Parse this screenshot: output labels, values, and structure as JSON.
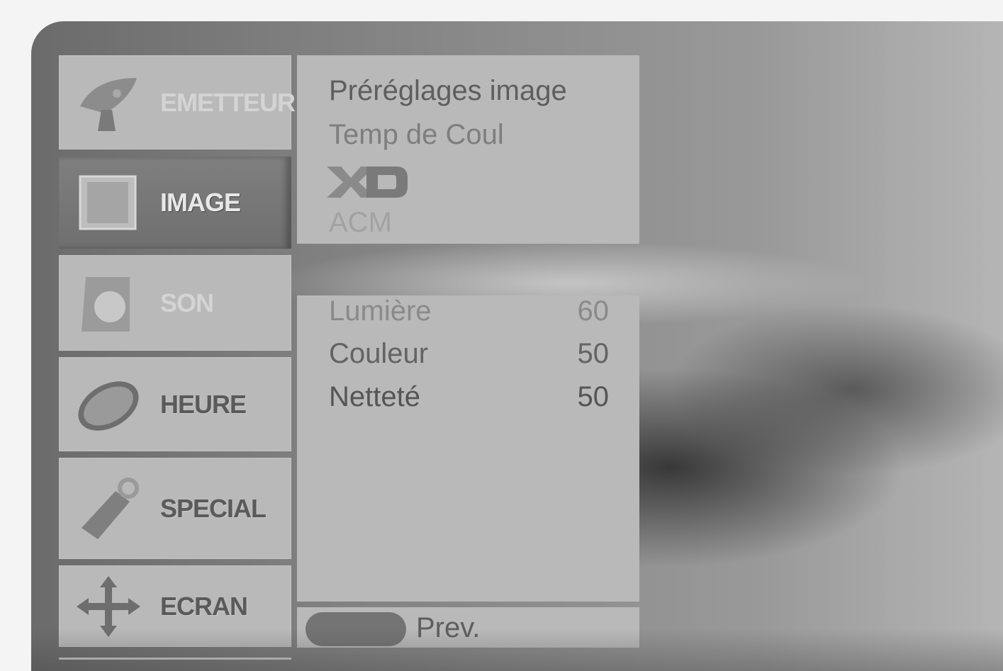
{
  "sidebar": {
    "items": [
      {
        "label": "EMETTEUR",
        "icon": "satellite-dish-icon",
        "state": "faded"
      },
      {
        "label": "IMAGE",
        "icon": "picture-frame-icon",
        "state": "active"
      },
      {
        "label": "SON",
        "icon": "speaker-icon",
        "state": "faded"
      },
      {
        "label": "HEURE",
        "icon": "clock-icon",
        "state": "normal"
      },
      {
        "label": "SPECIAL",
        "icon": "tag-icon",
        "state": "normal"
      },
      {
        "label": "ECRAN",
        "icon": "move-arrows-icon",
        "state": "normal"
      }
    ]
  },
  "submenu": {
    "items": [
      "Préréglages image",
      "Temp de Coul",
      "XD",
      "ACM"
    ]
  },
  "adjustments": {
    "rows": [
      {
        "name": "Lumière",
        "value": "60"
      },
      {
        "name": "Couleur",
        "value": "50"
      },
      {
        "name": "Netteté",
        "value": "50"
      }
    ]
  },
  "footer": {
    "prev_label": "Prev.",
    "prev_button_icon": "colored-key-pill"
  },
  "colors": {
    "panel": "#b9b9b9",
    "active_tab": "#777777",
    "text": "#5e5e5e"
  }
}
